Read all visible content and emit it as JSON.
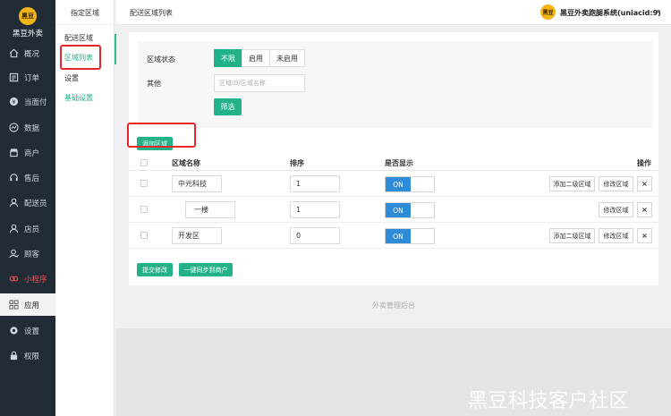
{
  "brand": {
    "logo_text": "黑豆",
    "name": "黑豆外卖"
  },
  "sidebar": {
    "items": [
      {
        "label": "概况",
        "icon": "home-icon"
      },
      {
        "label": "订单",
        "icon": "list-icon"
      },
      {
        "label": "当面付",
        "icon": "coin-icon"
      },
      {
        "label": "数据",
        "icon": "chart-icon"
      },
      {
        "label": "商户",
        "icon": "store-icon"
      },
      {
        "label": "售后",
        "icon": "headset-icon"
      },
      {
        "label": "配送员",
        "icon": "courier-icon"
      },
      {
        "label": "店员",
        "icon": "user-icon"
      },
      {
        "label": "顾客",
        "icon": "customer-icon"
      },
      {
        "label": "小程序",
        "icon": "miniprogram-icon"
      },
      {
        "label": "应用",
        "icon": "apps-icon"
      },
      {
        "label": "设置",
        "icon": "gear-icon"
      },
      {
        "label": "权限",
        "icon": "lock-icon"
      }
    ]
  },
  "subnav": {
    "title": "指定区域",
    "items": [
      "配送区域",
      "区域列表",
      "设置",
      "基础设置"
    ]
  },
  "header": {
    "page_title": "配送区域列表",
    "avatar_text": "黑豆",
    "user_name": "黑豆外卖跑腿系统(uniacid:9)",
    "caret": "▾"
  },
  "filter": {
    "status_label": "区域状态",
    "status_options": [
      "不限",
      "启用",
      "未启用"
    ],
    "other_label": "其他",
    "search_placeholder": "区域ID/区域名称",
    "search_button": "筛选"
  },
  "actions": {
    "add_area": "添加区域"
  },
  "table": {
    "headers": [
      "区域名称",
      "排序",
      "是否显示",
      "操作"
    ],
    "rows": [
      {
        "name": "中元科技",
        "sort": "1",
        "show": "ON",
        "add_child": "添加二级区域",
        "edit": "修改区域",
        "delete": "×"
      },
      {
        "name": "一楼",
        "sort": "1",
        "show": "ON",
        "add_child": "",
        "edit": "修改区域",
        "delete": "×"
      },
      {
        "name": "开发区",
        "sort": "0",
        "show": "ON",
        "add_child": "添加二级区域",
        "edit": "修改区域",
        "delete": "×"
      }
    ]
  },
  "bottom_buttons": {
    "submit": "提交修改",
    "sync": "一键同步到商户"
  },
  "footer": {
    "text": "外卖管理后台"
  },
  "watermark": "黑豆科技客户社区",
  "colors": {
    "accent": "#22b189",
    "toggle_on": "#2e8bd8",
    "sidebar_bg": "#222c37",
    "highlight": "#e5262b"
  }
}
